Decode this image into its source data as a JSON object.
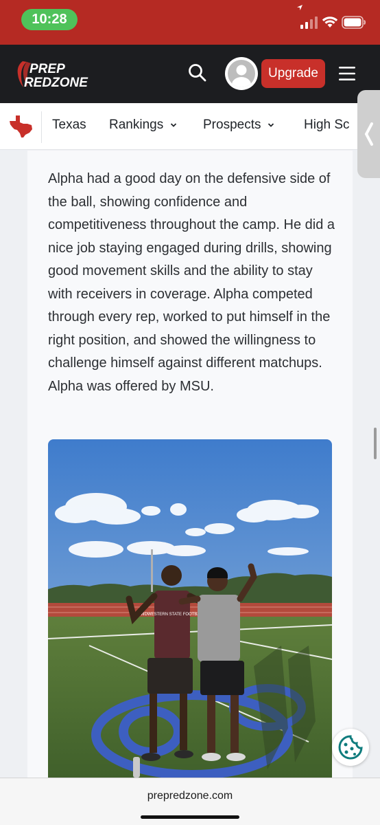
{
  "status_bar": {
    "time": "10:28"
  },
  "header": {
    "logo_line1": "PREP",
    "logo_line2": "REDZONE",
    "upgrade_label": "Upgrade"
  },
  "nav": {
    "items": [
      {
        "label": "Texas"
      },
      {
        "label": "Rankings"
      },
      {
        "label": "Prospects"
      },
      {
        "label": "High Sc"
      }
    ]
  },
  "article": {
    "paragraph": "Alpha had a good day on the defensive side of the ball, showing confidence and competitiveness throughout the camp. He did a nice job staying engaged during drills, showing good movement skills and the ability to stay with receivers in coverage. Alpha competed through every rep, worked to put himself in the right position, and showed the willingness to challenge himself against different matchups. Alpha was offered by MSU.",
    "photo_shirt_text": "MIDWESTERN STATE FOOTBALL"
  },
  "browser": {
    "url": "prepredzone.com"
  },
  "colors": {
    "brand_red": "#c8302a",
    "status_bar": "#b52a23",
    "header_bg": "#1c1d20"
  }
}
